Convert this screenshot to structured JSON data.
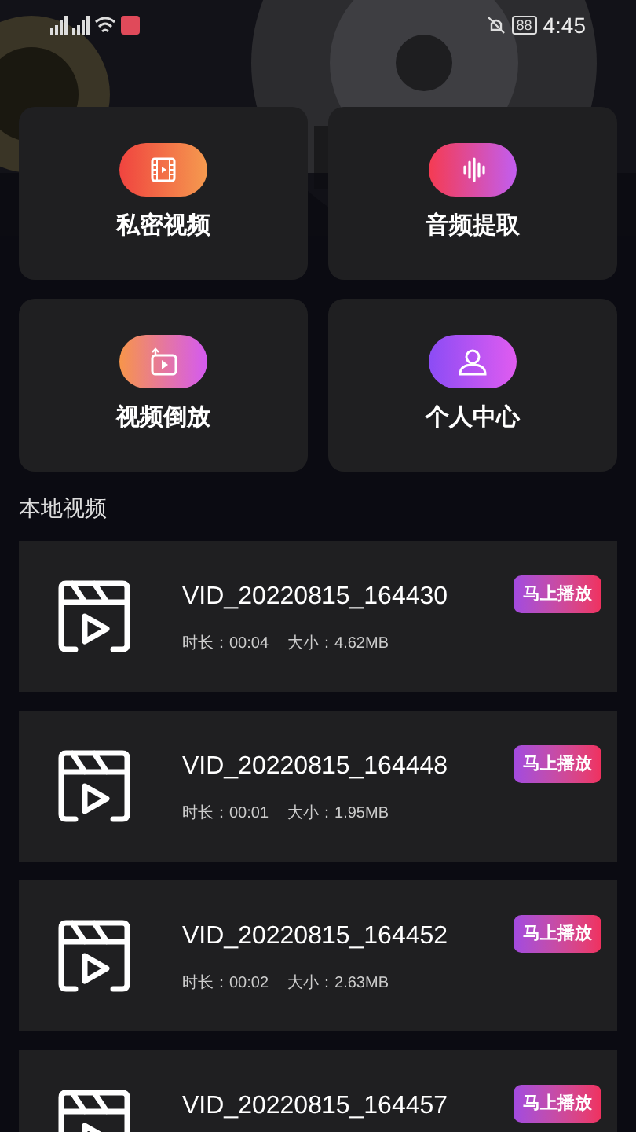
{
  "status_bar": {
    "battery": "88",
    "time": "4:45"
  },
  "features": [
    {
      "label": "私密视频"
    },
    {
      "label": "音频提取"
    },
    {
      "label": "视频倒放"
    },
    {
      "label": "个人中心"
    }
  ],
  "section_title": "本地视频",
  "videos": [
    {
      "name": "VID_20220815_164430",
      "duration": "时长：00:04",
      "size": "大小：4.62MB",
      "button": "马上播放"
    },
    {
      "name": "VID_20220815_164448",
      "duration": "时长：00:01",
      "size": "大小：1.95MB",
      "button": "马上播放"
    },
    {
      "name": "VID_20220815_164452",
      "duration": "时长：00:02",
      "size": "大小：2.63MB",
      "button": "马上播放"
    },
    {
      "name": "VID_20220815_164457",
      "button": "马上播放"
    }
  ]
}
